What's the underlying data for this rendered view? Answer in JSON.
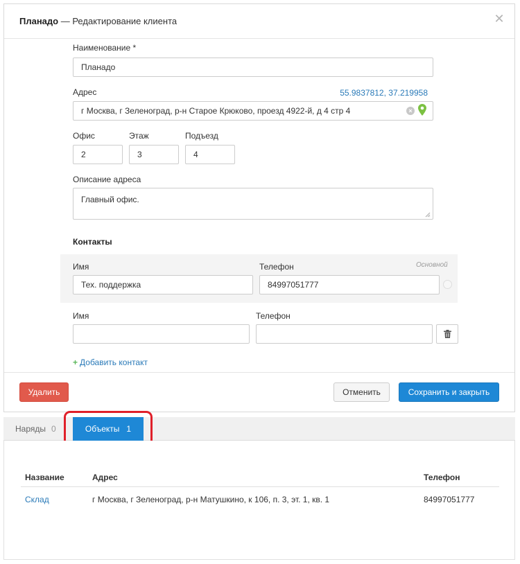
{
  "modal": {
    "title_bold": "Планадо",
    "title_rest": " — Редактирование клиента"
  },
  "form": {
    "name_label": "Наименование *",
    "name_value": "Планадо",
    "address_label": "Адрес",
    "coords": "55.9837812, 37.219958",
    "address_value": "г Москва, г Зеленоград, р-н Старое Крюково, проезд 4922-й, д 4 стр 4",
    "office_label": "Офис",
    "office_value": "2",
    "floor_label": "Этаж",
    "floor_value": "3",
    "entrance_label": "Подъезд",
    "entrance_value": "4",
    "desc_label": "Описание адреса",
    "desc_value": "Главный офис."
  },
  "contacts": {
    "title": "Контакты",
    "main_hint": "Основной",
    "rows": [
      {
        "name_label": "Имя",
        "name_value": "Тех. поддержка",
        "phone_label": "Телефон",
        "phone_value": "84997051777"
      },
      {
        "name_label": "Имя",
        "name_value": "",
        "phone_label": "Телефон",
        "phone_value": ""
      }
    ],
    "add_label": "Добавить контакт"
  },
  "buttons": {
    "delete": "Удалить",
    "cancel": "Отменить",
    "save_close": "Сохранить и закрыть"
  },
  "colors": {
    "primary": "#1e88d6",
    "danger": "#e15a4c",
    "link": "#2a7ab8",
    "pin": "#7cc142",
    "highlight": "#e0202a"
  },
  "tabs": [
    {
      "label": "Наряды",
      "count": "0",
      "active": false
    },
    {
      "label": "Объекты",
      "count": "1",
      "active": true
    }
  ],
  "objects_table": {
    "headers": {
      "name": "Название",
      "address": "Адрес",
      "phone": "Телефон"
    },
    "rows": [
      {
        "name": "Склад",
        "address": "г Москва, г Зеленоград, р-н Матушкино, к 106, п. 3, эт. 1, кв. 1",
        "phone": "84997051777"
      }
    ]
  },
  "icons": {
    "close": "close-icon",
    "clear": "clear-input-icon",
    "pin": "map-pin-icon",
    "trash": "trash-icon",
    "plus": "plus-icon",
    "radio": "main-contact-radio-icon"
  }
}
